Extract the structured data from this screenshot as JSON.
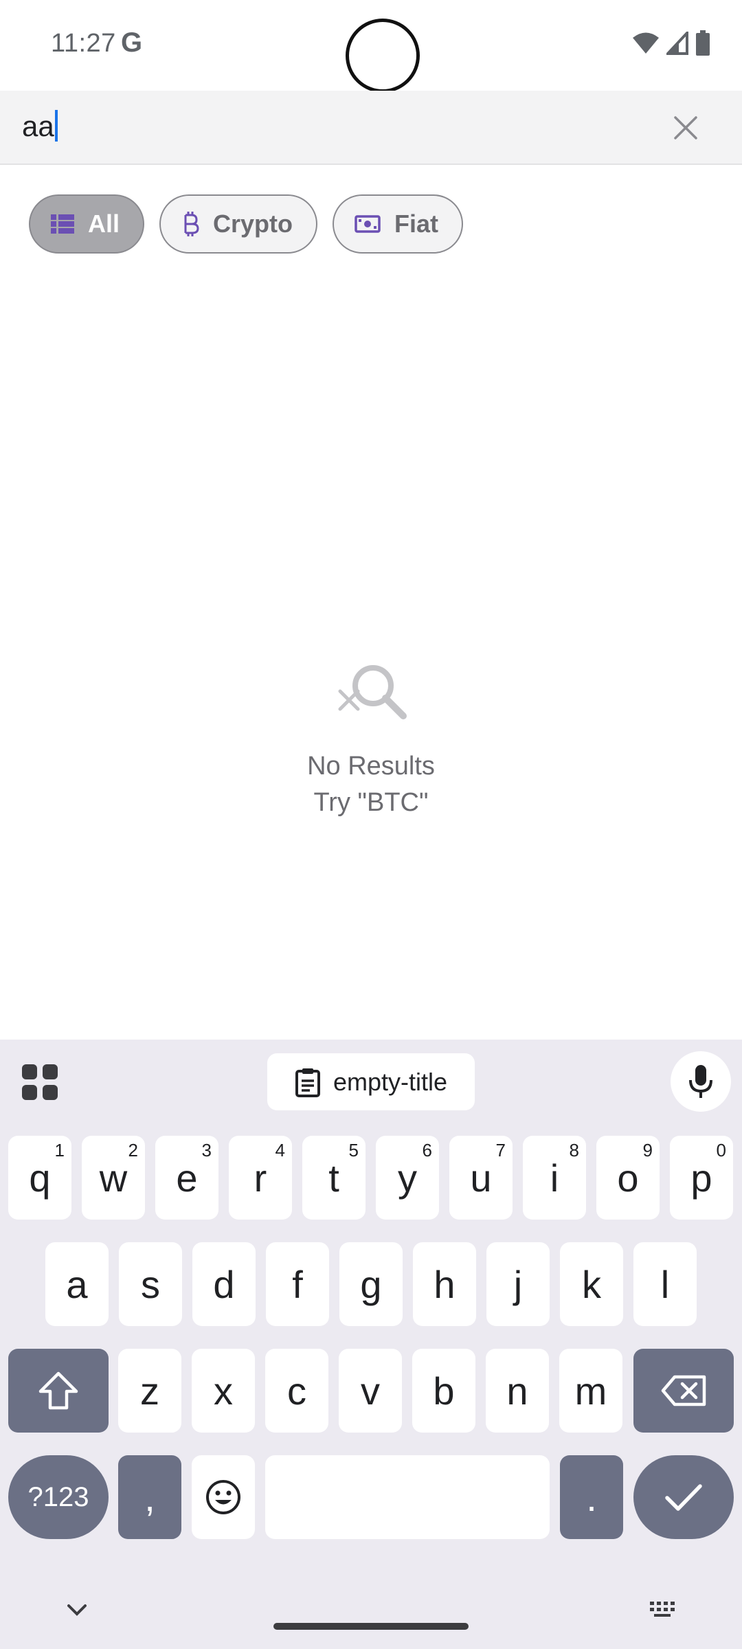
{
  "status_bar": {
    "time": "11:27",
    "g_logo": "G"
  },
  "search": {
    "query": "aa"
  },
  "chips": [
    {
      "label": "All",
      "icon": "list-icon",
      "selected": true
    },
    {
      "label": "Crypto",
      "icon": "bitcoin-icon",
      "selected": false
    },
    {
      "label": "Fiat",
      "icon": "banknote-icon",
      "selected": false
    }
  ],
  "empty_state": {
    "title": "No Results",
    "hint": "Try \"BTC\""
  },
  "keyboard": {
    "clipboard_suggestion": "empty-title",
    "row1": [
      {
        "k": "q",
        "n": "1"
      },
      {
        "k": "w",
        "n": "2"
      },
      {
        "k": "e",
        "n": "3"
      },
      {
        "k": "r",
        "n": "4"
      },
      {
        "k": "t",
        "n": "5"
      },
      {
        "k": "y",
        "n": "6"
      },
      {
        "k": "u",
        "n": "7"
      },
      {
        "k": "i",
        "n": "8"
      },
      {
        "k": "o",
        "n": "9"
      },
      {
        "k": "p",
        "n": "0"
      }
    ],
    "row2": [
      "a",
      "s",
      "d",
      "f",
      "g",
      "h",
      "j",
      "k",
      "l"
    ],
    "row3": [
      "z",
      "x",
      "c",
      "v",
      "b",
      "n",
      "m"
    ],
    "symbols_label": "?123",
    "comma": ",",
    "period": "."
  },
  "colors": {
    "accent": "#6b4fb3",
    "key_dark": "#6b7085",
    "keyboard_bg": "#eceaf1",
    "caret": "#1a73e8"
  }
}
